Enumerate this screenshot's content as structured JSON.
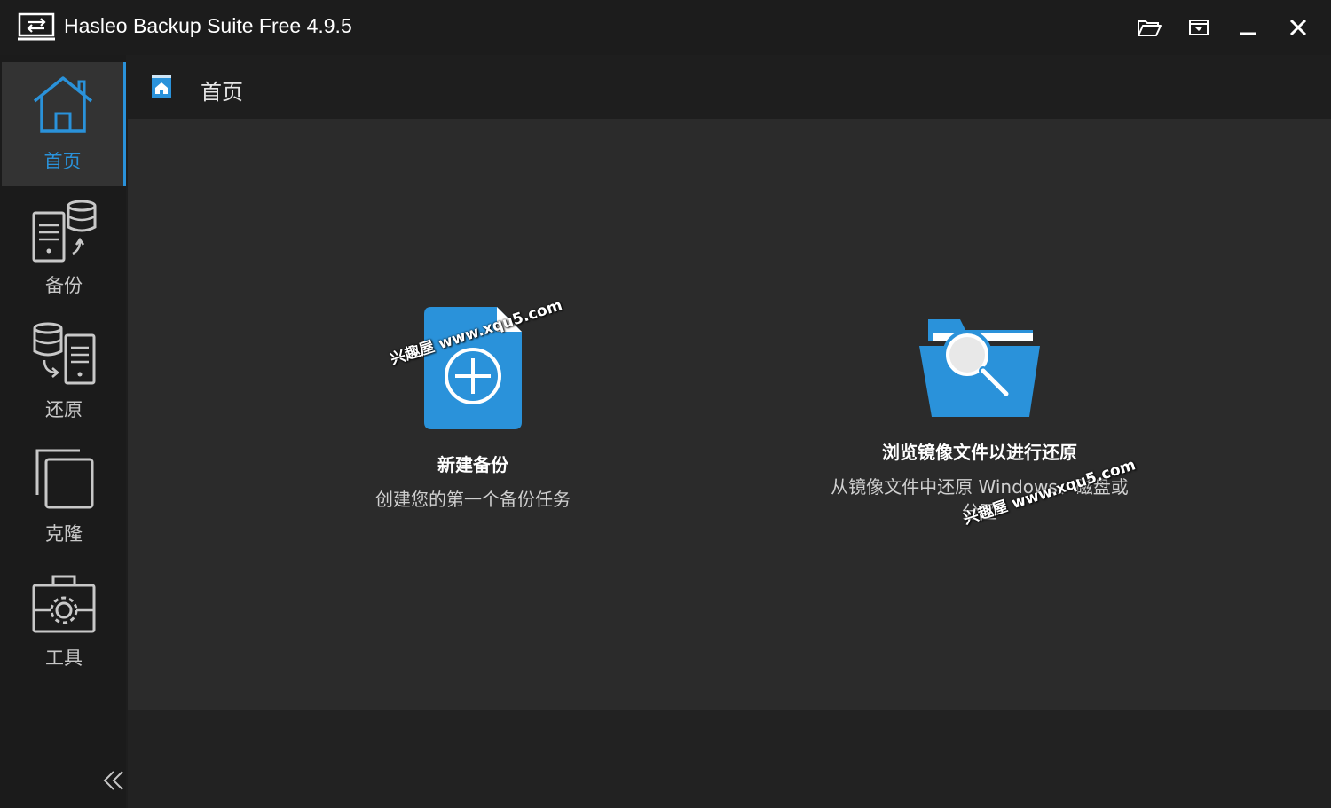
{
  "window": {
    "title": "Hasleo Backup Suite Free 4.9.5",
    "controls": [
      "folder-open-icon",
      "window-menu-icon",
      "minimize-icon",
      "close-icon"
    ]
  },
  "sidebar": {
    "items": [
      {
        "label": "首页",
        "icon": "home-icon",
        "active": true
      },
      {
        "label": "备份",
        "icon": "backup-icon",
        "active": false
      },
      {
        "label": "还原",
        "icon": "restore-icon",
        "active": false
      },
      {
        "label": "克隆",
        "icon": "clone-icon",
        "active": false
      },
      {
        "label": "工具",
        "icon": "tools-icon",
        "active": false
      }
    ],
    "collapse_icon": "double-chevron-left-icon"
  },
  "header": {
    "title": "首页",
    "icon": "home-small-icon"
  },
  "cards": [
    {
      "title": "新建备份",
      "description": "创建您的第一个备份任务",
      "icon": "new-backup-icon"
    },
    {
      "title": "浏览镜像文件以进行还原",
      "description": "从镜像文件中还原 Windows、磁盘或分区",
      "icon": "browse-image-icon"
    }
  ],
  "watermarks": [
    "兴趣屋 www.xqu5.com",
    "兴趣屋 www.xqu5.com"
  ],
  "colors": {
    "accent": "#2a92da",
    "background": "#2b2b2b",
    "sidebar": "#1b1b1b"
  }
}
